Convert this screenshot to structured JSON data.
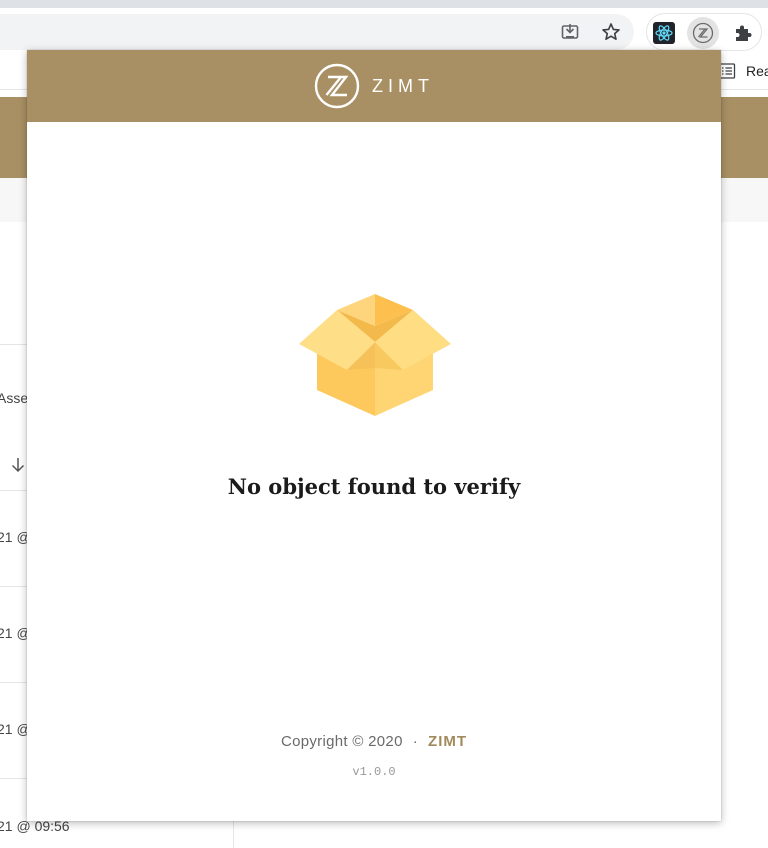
{
  "browser": {
    "reading_list_label": "Rea",
    "icons": [
      "install-app-icon",
      "bookmark-star-icon",
      "react-devtools-icon",
      "zimt-extension-icon",
      "extensions-puzzle-icon",
      "reading-list-icon"
    ]
  },
  "background_page": {
    "column_label_partial": "Asse",
    "rows": [
      {
        "date_partial": "21 @"
      },
      {
        "date_partial": "21 @"
      },
      {
        "date_partial": "21 @"
      },
      {
        "date_partial": "21 @ 09:56"
      }
    ],
    "header_color": "#a99064"
  },
  "popup": {
    "brand_name": "ZIMT",
    "empty_state": {
      "icon": "open-box-icon",
      "message": "No object found to verify"
    },
    "footer": {
      "copyright": "Copyright © 2020",
      "separator": "·",
      "brand_link": "ZIMT",
      "version": "v1.0.0"
    },
    "colors": {
      "header": "#a99064",
      "brand_link": "#a38a5c",
      "box": "#fdd06b"
    }
  }
}
